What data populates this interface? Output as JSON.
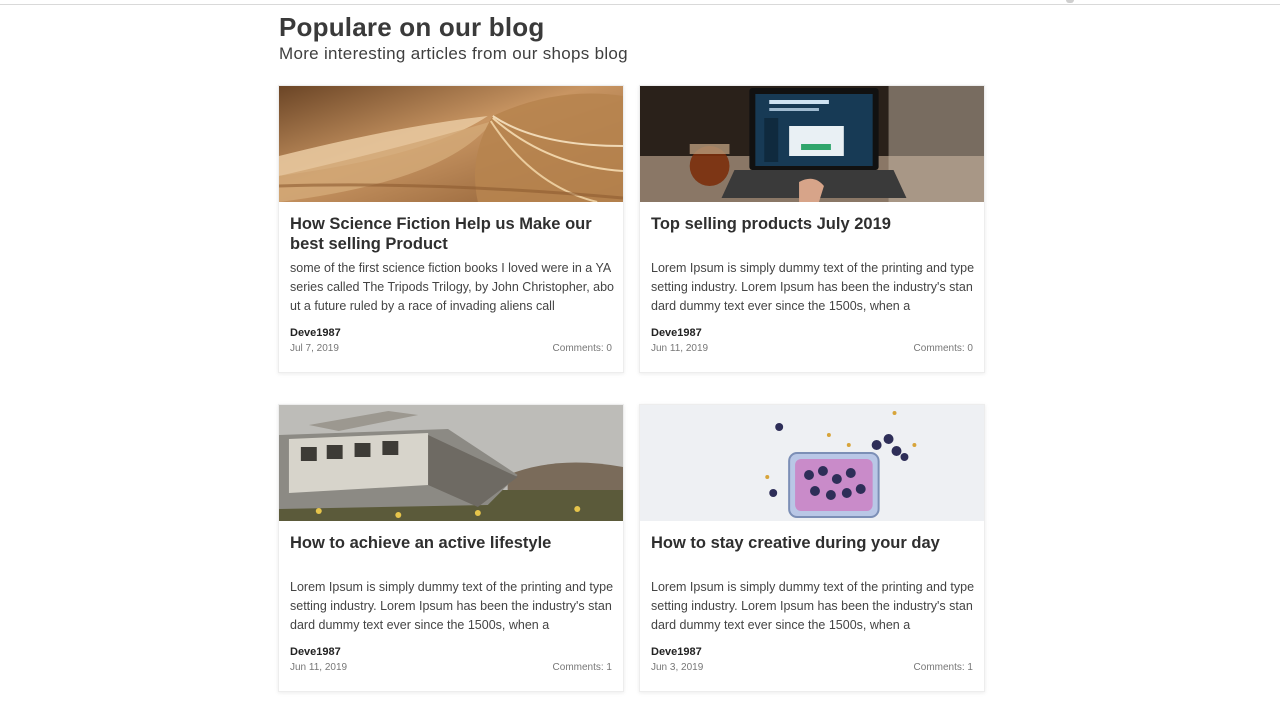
{
  "section": {
    "title": "Populare on our blog",
    "subtitle": "More interesting articles from our shops blog"
  },
  "posts": [
    {
      "image": "open-book-photo",
      "title": "How Science Fiction Help us Make our best selling Product",
      "excerpt": "some of the first science fiction books I loved were in a YA series called The Tripods Trilogy, by John Christopher, about a future ruled by a race of invading aliens call",
      "author": "Deve1987",
      "date": "Jul 7, 2019",
      "comments": "Comments: 0"
    },
    {
      "image": "laptop-revenue-photo",
      "title": "Top selling products July 2019",
      "excerpt": "Lorem Ipsum is simply dummy text of the printing and typesetting industry. Lorem Ipsum has been the industry's standard dummy text ever since the 1500s, when a",
      "author": "Deve1987",
      "date": "Jun 11, 2019",
      "comments": "Comments: 0"
    },
    {
      "image": "shipwreck-photo",
      "title": "How to achieve an active lifestyle",
      "excerpt": "Lorem Ipsum is simply dummy text of the printing and typesetting industry. Lorem Ipsum has been the industry's standard dummy text ever since the 1500s, when a",
      "author": "Deve1987",
      "date": "Jun 11, 2019",
      "comments": "Comments: 1"
    },
    {
      "image": "blueberry-bowl-photo",
      "title": "How to stay creative during your day",
      "excerpt": "Lorem Ipsum is simply dummy text of the printing and typesetting industry. Lorem Ipsum has been the industry's standard dummy text ever since the 1500s, when a",
      "author": "Deve1987",
      "date": "Jun 3, 2019",
      "comments": "Comments: 1"
    }
  ]
}
